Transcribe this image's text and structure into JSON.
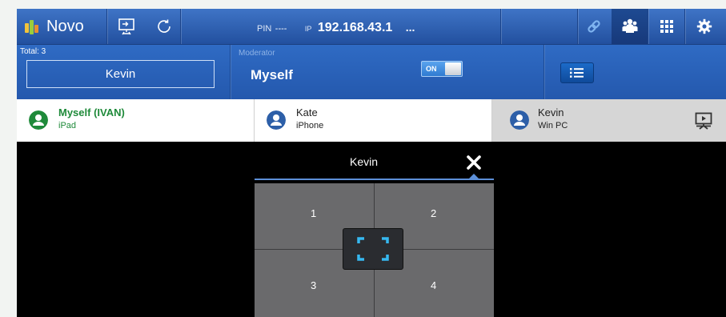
{
  "app": {
    "name": "Novo"
  },
  "toolbar": {
    "pin_label": "PIN",
    "pin_value": "----",
    "ip_label": "IP",
    "ip_value": "192.168.43.1",
    "ip_more": "..."
  },
  "moderator_bar": {
    "total_label": "Total: 3",
    "presenter": "Kevin",
    "moderator_label": "Moderator",
    "moderator_value": "Myself",
    "toggle_label": "ON"
  },
  "participants": [
    {
      "name": "Myself (IVAN)",
      "device": "iPad",
      "color": "#1f8a3a",
      "selected": false
    },
    {
      "name": "Kate",
      "device": "iPhone",
      "color": "#2d5fa8",
      "selected": false
    },
    {
      "name": "Kevin",
      "device": "Win PC",
      "color": "#2d5fa8",
      "selected": true
    }
  ],
  "split_panel": {
    "title": "Kevin",
    "quadrants": [
      "1",
      "2",
      "3",
      "4"
    ]
  },
  "colors": {
    "toolbar_blue": "#2a5db0",
    "accent_green": "#1f8a3a",
    "accent_blue": "#2d5fa8",
    "fullscreen_cyan": "#36b8f0"
  }
}
